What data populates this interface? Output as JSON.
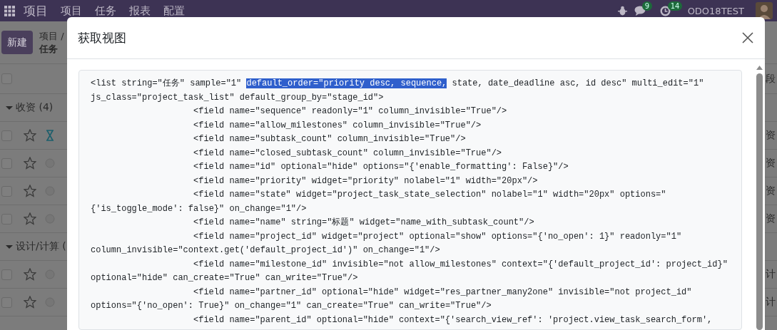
{
  "navbar": {
    "brand": "项目",
    "menu": [
      "项目",
      "任务",
      "报表",
      "配置"
    ],
    "chat_badge": "9",
    "activity_badge": "14",
    "user": "ODO18TEST"
  },
  "control_panel": {
    "new_button": "新建",
    "breadcrumb": "项目 /",
    "current": "任务"
  },
  "list": {
    "stage_header": "段",
    "all_checked": false,
    "groups": [
      {
        "label": "收资 (4)",
        "expanded": true,
        "rows": [
          {
            "checked": false,
            "starred": false,
            "kind": "waiting",
            "stage": "资"
          },
          {
            "checked": false,
            "starred": false,
            "kind": "normal",
            "stage": "资"
          },
          {
            "checked": false,
            "starred": false,
            "kind": "normal",
            "stage": "资"
          },
          {
            "checked": false,
            "starred": false,
            "kind": "normal",
            "stage": "资"
          }
        ]
      },
      {
        "label": "设计/计算 (",
        "expanded": true,
        "rows": [
          {
            "checked": false,
            "starred": false,
            "kind": "normal",
            "stage": "计"
          },
          {
            "checked": false,
            "starred": false,
            "kind": "normal",
            "stage": "计"
          }
        ]
      }
    ]
  },
  "dialog": {
    "title": "获取视图",
    "code_lines": [
      {
        "indent": false,
        "parts": [
          {
            "text": "<list string=\"任务\" sample=\"1\" ",
            "selected": false
          },
          {
            "text": "default_order=\"priority desc, sequence,",
            "selected": true
          },
          {
            "text": " state, date_deadline asc, id desc\" multi_edit=\"1\"",
            "selected": false
          }
        ]
      },
      {
        "indent": false,
        "text": "js_class=\"project_task_list\" default_group_by=\"stage_id\">"
      },
      {
        "indent": true,
        "text": "<field name=\"sequence\" readonly=\"1\" column_invisible=\"True\"/>"
      },
      {
        "indent": true,
        "text": "<field name=\"allow_milestones\" column_invisible=\"True\"/>"
      },
      {
        "indent": true,
        "text": "<field name=\"subtask_count\" column_invisible=\"True\"/>"
      },
      {
        "indent": true,
        "text": "<field name=\"closed_subtask_count\" column_invisible=\"True\"/>"
      },
      {
        "indent": true,
        "text": "<field name=\"id\" optional=\"hide\" options=\"{'enable_formatting': False}\"/>"
      },
      {
        "indent": true,
        "text": "<field name=\"priority\" widget=\"priority\" nolabel=\"1\" width=\"20px\"/>"
      },
      {
        "indent": true,
        "text": "<field name=\"state\" widget=\"project_task_state_selection\" nolabel=\"1\" width=\"20px\" options=\""
      },
      {
        "indent": false,
        "text": "{'is_toggle_mode': false}\" on_change=\"1\"/>"
      },
      {
        "indent": true,
        "text": "<field name=\"name\" string=\"标题\" widget=\"name_with_subtask_count\"/>"
      },
      {
        "indent": true,
        "text": "<field name=\"project_id\" widget=\"project\" optional=\"show\" options=\"{'no_open': 1}\" readonly=\"1\""
      },
      {
        "indent": false,
        "text": "column_invisible=\"context.get('default_project_id')\" on_change=\"1\"/>"
      },
      {
        "indent": true,
        "text": "<field name=\"milestone_id\" invisible=\"not allow_milestones\" context=\"{'default_project_id': project_id}\""
      },
      {
        "indent": false,
        "text": "optional=\"hide\" can_create=\"True\" can_write=\"True\"/>"
      },
      {
        "indent": true,
        "text": "<field name=\"partner_id\" optional=\"hide\" widget=\"res_partner_many2one\" invisible=\"not project_id\""
      },
      {
        "indent": false,
        "text": "options=\"{'no_open': True}\" on_change=\"1\" can_create=\"True\" can_write=\"True\"/>"
      },
      {
        "indent": true,
        "text": "<field name=\"parent_id\" optional=\"hide\" context=\"{'search_view_ref': 'project.view_task_search_form',"
      }
    ]
  }
}
